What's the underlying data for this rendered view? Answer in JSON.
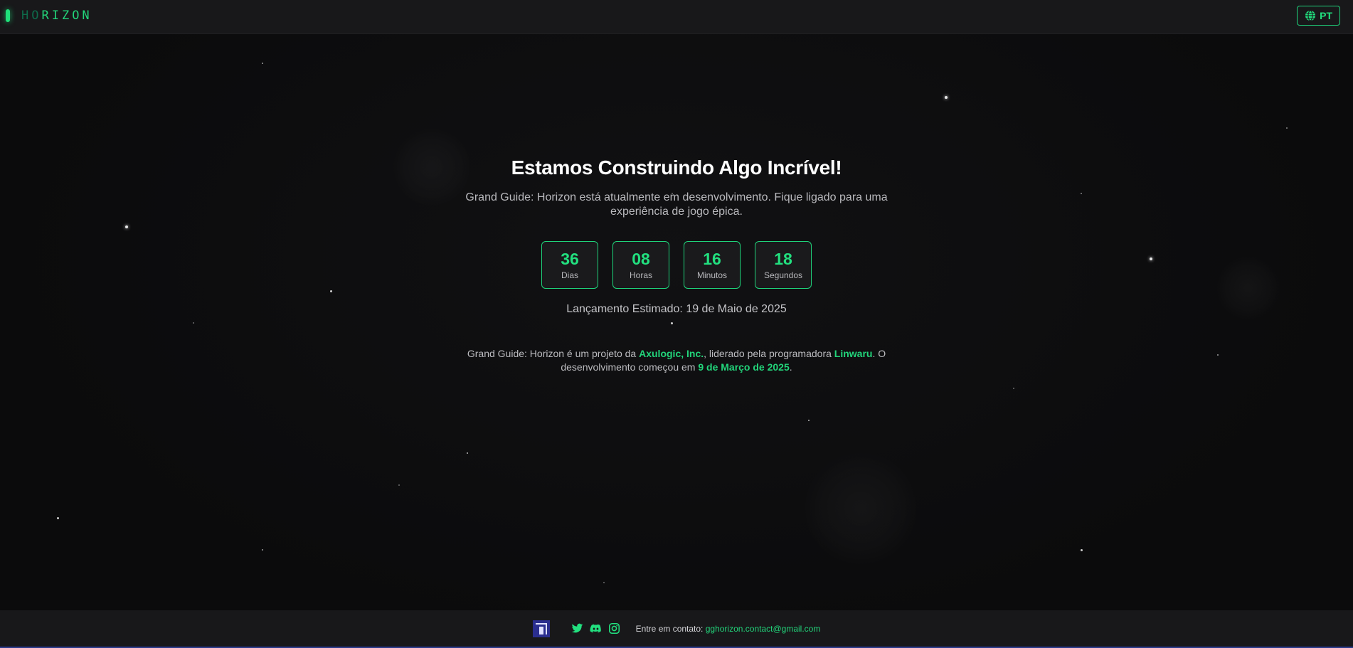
{
  "header": {
    "logo": {
      "text_dim": "HO",
      "text_bright": "RIZON"
    },
    "language_button": {
      "icon": "globe-icon",
      "label": "PT"
    }
  },
  "main": {
    "headline": "Estamos Construindo Algo Incrível!",
    "subtitle": "Grand Guide: Horizon está atualmente em desenvolvimento. Fique ligado para uma experiência de jogo épica.",
    "countdown": [
      {
        "value": "36",
        "label": "Dias"
      },
      {
        "value": "08",
        "label": "Horas"
      },
      {
        "value": "16",
        "label": "Minutos"
      },
      {
        "value": "18",
        "label": "Segundos"
      }
    ],
    "launch_estimate": "Lançamento Estimado: 19 de Maio de 2025",
    "credits": {
      "part1": "Grand Guide: Horizon é um projeto da ",
      "company": "Axulogic, Inc.",
      "part2": ", liderado pela programadora ",
      "developer": "Linwaru",
      "part3": ". O desenvolvimento começou em ",
      "start_date": "9 de Março de 2025",
      "part4": "."
    }
  },
  "footer": {
    "brand_icon": "axulogic-logo-icon",
    "social_icons": [
      "twitter-icon",
      "discord-icon",
      "instagram-icon"
    ],
    "contact_label": "Entre em contato: ",
    "contact_email": "gghorizon.contact@gmail.com"
  },
  "colors": {
    "accent": "#22e07f",
    "background": "#0c0c0d",
    "panel": "#18181a",
    "text": "#ffffff",
    "muted_text": "#b9b9bd"
  }
}
